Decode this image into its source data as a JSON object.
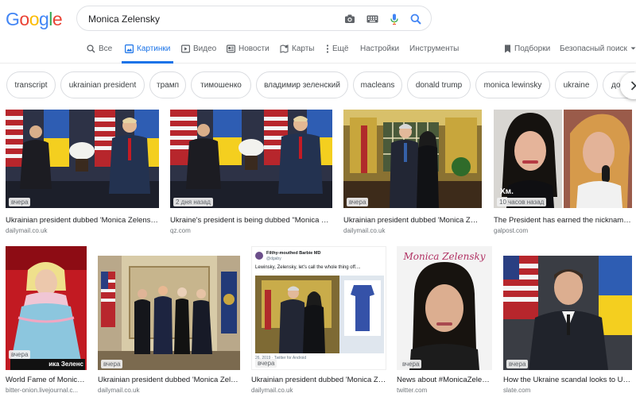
{
  "logo": "Google",
  "search": {
    "value": "Monica Zelensky"
  },
  "tabs": [
    {
      "label": "Все",
      "icon": "search-icon"
    },
    {
      "label": "Картинки",
      "icon": "image-icon"
    },
    {
      "label": "Видео",
      "icon": "video-icon"
    },
    {
      "label": "Новости",
      "icon": "news-icon"
    },
    {
      "label": "Карты",
      "icon": "map-icon"
    },
    {
      "label": "Ещё",
      "icon": "more-vert-icon"
    },
    {
      "label": "Настройки"
    },
    {
      "label": "Инструменты"
    }
  ],
  "right_tabs": {
    "saved": "Подборки",
    "safesearch": "Безопасный поиск"
  },
  "chips": [
    "transcript",
    "ukrainian president",
    "трамп",
    "тимошенко",
    "владимир зеленский",
    "macleans",
    "donald trump",
    "monica lewinsky",
    "ukraine",
    "дон"
  ],
  "results_row1": [
    {
      "title": "Ukrainian president dubbed 'Monica Zelensky'...",
      "source": "dailymail.co.uk",
      "badge": "вчера"
    },
    {
      "title": "Ukraine's president is being dubbed \"Monica Zel...",
      "source": "qz.com",
      "badge": "2 дня назад"
    },
    {
      "title": "Ukrainian president dubbed 'Monica Zele...",
      "source": "dailymail.co.uk",
      "badge": "вчера"
    },
    {
      "title": "The President has earned the nickname \"...",
      "source": "galpost.com",
      "badge": "10 часов назад",
      "overlay": "Хм."
    }
  ],
  "results_row2": [
    {
      "title": "World Fame of Monica ...",
      "source": "bitter-onion.livejournal.c...",
      "badge": "вчера",
      "overlay": "ика Зеленс"
    },
    {
      "title": "Ukrainian president dubbed 'Monica Zele...",
      "source": "dailymail.co.uk",
      "badge": "вчера"
    },
    {
      "title": "Ukrainian president dubbed 'Monica Zele...",
      "source": "dailymail.co.uk",
      "badge": "вчера",
      "tweet_user": "Filthy-mouthed Barbie MD",
      "tweet_handle": "@dgaby",
      "tweet_text": "Lewinsky, Zelensky, let's call the whole thing off....",
      "tweet_footer": "26, 2019 · Twitter for Android"
    },
    {
      "title": "News about #MonicaZelen...",
      "source": "twitter.com",
      "badge": "вчера",
      "overlay": "Monica Zelensky"
    },
    {
      "title": "How the Ukraine scandal looks to Ukr...",
      "source": "slate.com",
      "badge": "вчера"
    }
  ],
  "colors": {
    "accent": "#1a73e8",
    "blue": "#4285F4",
    "red": "#EA4335",
    "yellow": "#FBBC05",
    "green": "#34A853"
  }
}
